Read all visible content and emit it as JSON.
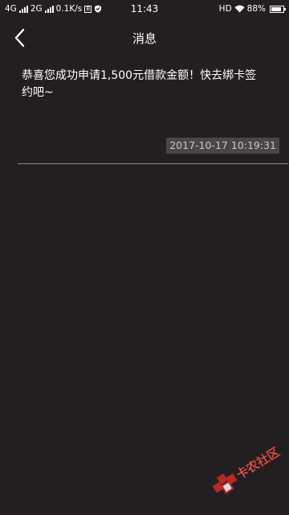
{
  "status_bar": {
    "network1": "4G",
    "network2": "2G",
    "speed": "0.1K/s",
    "box_glyph": "B",
    "time": "11:43",
    "hd": "HD",
    "battery": "88%",
    "battery_level": 0.88
  },
  "header": {
    "title": "消息",
    "back_icon": "chevron-left-icon"
  },
  "message": {
    "text": "恭喜您成功申请1,500元借款金额！快去绑卡签约吧~",
    "timestamp": "2017-10-17 10:19:31"
  },
  "watermark": {
    "text": "卡农社区"
  },
  "colors": {
    "background": "#231f20",
    "text": "#ffffff",
    "timestamp_bg": "#4a4647",
    "timestamp_text": "#c9c6c6",
    "divider": "#8a8788",
    "watermark_red": "#d42a2a"
  }
}
